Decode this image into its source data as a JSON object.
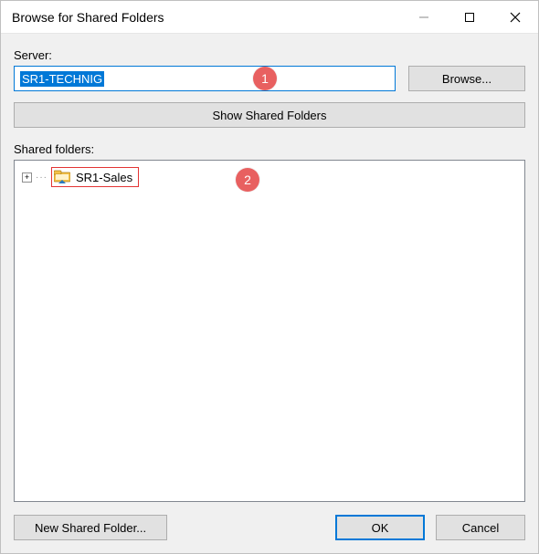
{
  "window": {
    "title": "Browse for Shared Folders"
  },
  "server": {
    "label": "Server:",
    "value": "SR1-TECHNIG",
    "browse_label": "Browse..."
  },
  "show_shared_label": "Show Shared Folders",
  "shared_folders": {
    "label": "Shared folders:",
    "items": [
      {
        "name": "SR1-Sales",
        "highlighted": true
      }
    ]
  },
  "footer": {
    "new_label": "New Shared Folder...",
    "ok_label": "OK",
    "cancel_label": "Cancel"
  },
  "annotations": {
    "badge1": "1",
    "badge2": "2"
  }
}
